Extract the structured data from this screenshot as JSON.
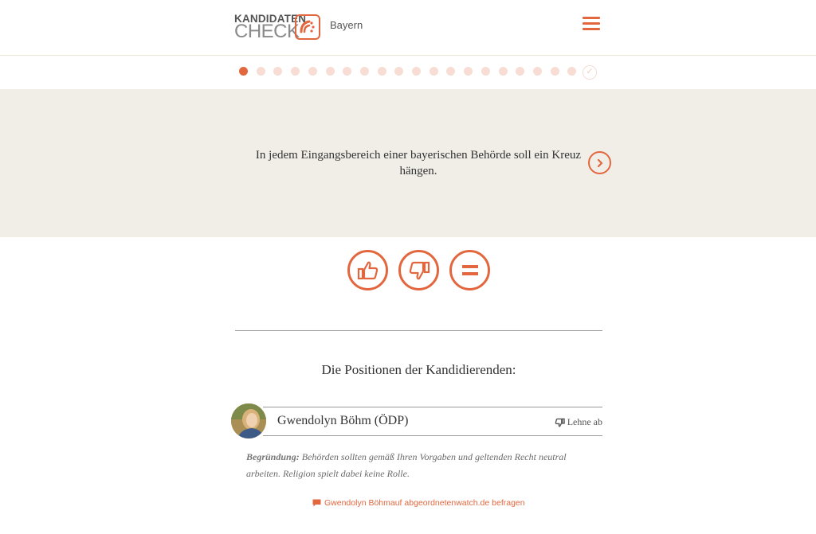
{
  "header": {
    "logo_line1": "KANDIDATEN",
    "logo_line2": "CHECK",
    "region": "Bayern",
    "accent_color": "#e2673f"
  },
  "progress": {
    "total_steps": 21,
    "current_step": 1,
    "final_icon": "check-icon"
  },
  "question": {
    "text": "In jedem Eingangsbereich einer bayerischen Behörde soll ein Kreuz hängen.",
    "next_icon": "chevron-right-icon"
  },
  "vote_buttons": [
    {
      "name": "agree",
      "icon": "thumbs-up-icon"
    },
    {
      "name": "disagree",
      "icon": "thumbs-down-icon"
    },
    {
      "name": "neutral",
      "icon": "equals-icon"
    }
  ],
  "positions": {
    "title": "Die Positionen der Kandidierenden:",
    "candidate": {
      "name": "Gwendolyn Böhm (ÖDP)",
      "stance": "Lehne ab",
      "stance_icon": "thumbs-down-icon",
      "reason_label": "Begründung:",
      "reason_text": " Behörden sollten gemäß Ihren Vorgaben und geltenden Recht neutral arbeiten. Religion spielt dabei keine Rolle.",
      "ask_link": "Gwendolyn Böhmauf abgeordnetenwatch.de befragen",
      "ask_icon": "speech-bubble-icon"
    }
  }
}
